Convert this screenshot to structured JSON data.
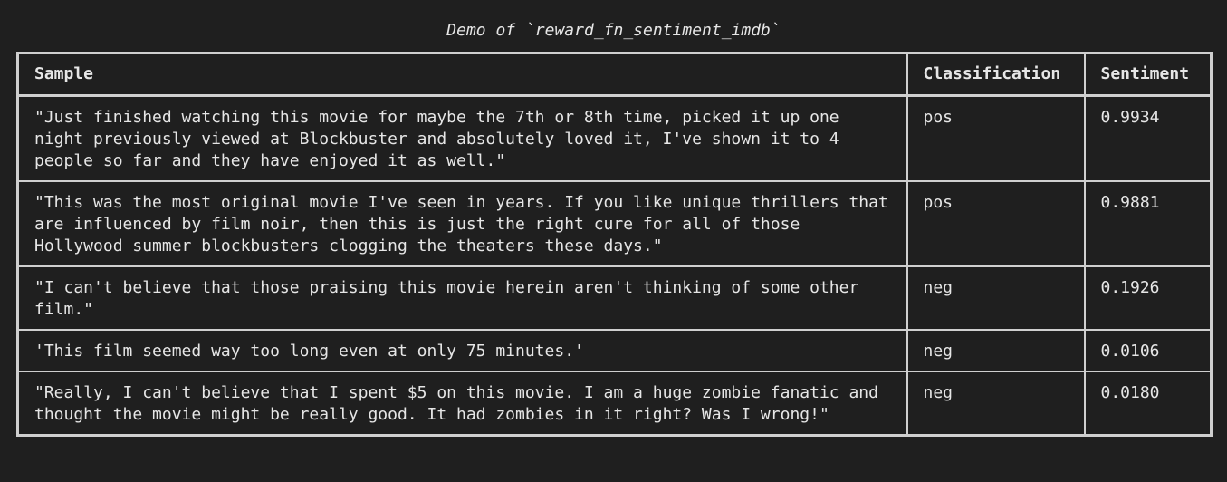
{
  "caption": "Demo of `reward_fn_sentiment_imdb`",
  "table": {
    "headers": [
      "Sample",
      "Classification",
      "Sentiment"
    ],
    "rows": [
      {
        "sample": "\"Just finished watching this movie for maybe the 7th or 8th time, picked it up one night previously viewed at Blockbuster and absolutely loved it, I've shown it to 4 people so far and they have enjoyed it as well.\"",
        "classification": "pos",
        "sentiment": "0.9934"
      },
      {
        "sample": "\"This was the most original movie I've seen in years. If you like unique thrillers that are influenced by film noir, then this is just the right cure for all of those Hollywood summer blockbusters clogging the theaters these days.\"",
        "classification": "pos",
        "sentiment": "0.9881"
      },
      {
        "sample": "\"I can't believe that those praising this movie herein aren't thinking of some other film.\"",
        "classification": "neg",
        "sentiment": "0.1926"
      },
      {
        "sample": "'This film seemed way too long even at only 75 minutes.'",
        "classification": "neg",
        "sentiment": "0.0106"
      },
      {
        "sample": "\"Really, I can't believe that I spent $5 on this movie. I am a huge zombie fanatic and thought the movie might be really good. It had zombies in it right? Was I wrong!\"",
        "classification": "neg",
        "sentiment": "0.0180"
      }
    ]
  }
}
